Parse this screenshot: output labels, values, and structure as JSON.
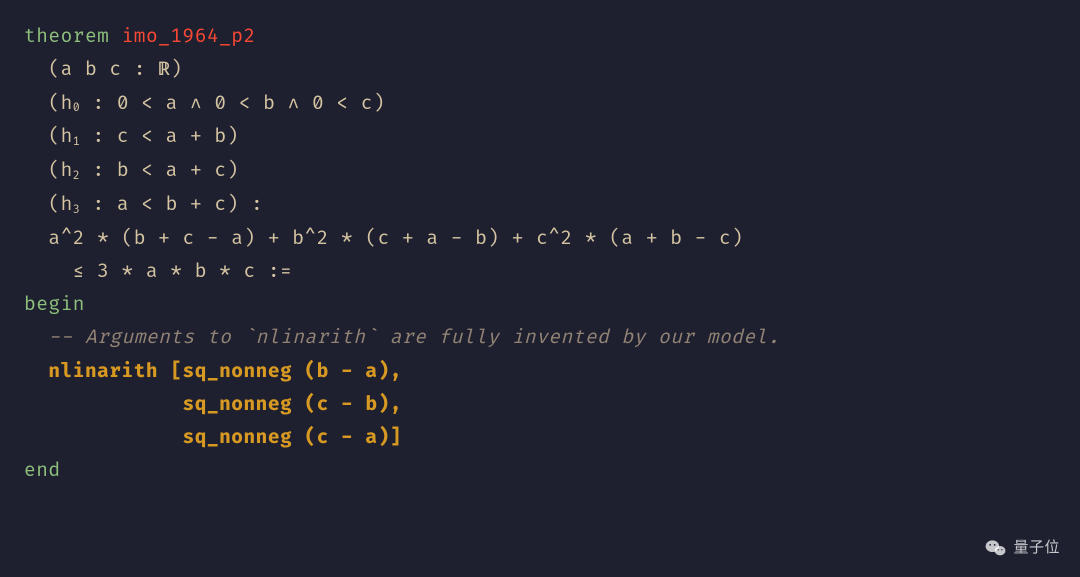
{
  "code": {
    "line1": {
      "keyword": "theorem",
      "name": "imo_1964_p2"
    },
    "line2": "  (a b c : ℝ)",
    "line3": {
      "prefix": "  (h",
      "sub": "0",
      "rest": " : 0 < a ∧ 0 < b ∧ 0 < c)"
    },
    "line4": {
      "prefix": "  (h",
      "sub": "1",
      "rest": " : c < a + b)"
    },
    "line5": {
      "prefix": "  (h",
      "sub": "2",
      "rest": " : b < a + c)"
    },
    "line6": {
      "prefix": "  (h",
      "sub": "3",
      "rest": " : a < b + c) :"
    },
    "line7": "  a^2 * (b + c - a) + b^2 * (c + a - b) + c^2 * (a + b - c)",
    "line8": "    ≤ 3 * a * b * c :=",
    "line9": "begin",
    "line10": "  -- Arguments to `nlinarith` are fully invented by our model.",
    "line11": {
      "indent": "  ",
      "tactic": "nlinarith",
      "args": " [sq_nonneg (b - a),"
    },
    "line12": {
      "indent": "             ",
      "args": "sq_nonneg (c - b),"
    },
    "line13": {
      "indent": "             ",
      "args": "sq_nonneg (c - a)]"
    },
    "line14": "end"
  },
  "watermark": {
    "text": "量子位"
  }
}
